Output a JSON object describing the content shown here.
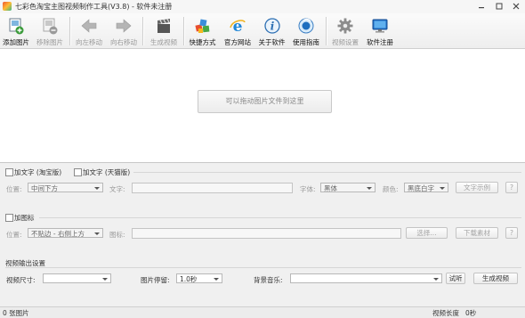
{
  "window": {
    "title": "七彩色淘宝主图视频制作工具(V3.8) - 软件未注册"
  },
  "toolbar": {
    "items": [
      {
        "label": "添加图片",
        "icon": "add-image-icon",
        "enabled": true
      },
      {
        "label": "移除图片",
        "icon": "remove-image-icon",
        "enabled": false
      },
      {
        "label": "向左移动",
        "icon": "arrow-left-icon",
        "enabled": false
      },
      {
        "label": "向右移动",
        "icon": "arrow-right-icon",
        "enabled": false
      },
      {
        "label": "生成视频",
        "icon": "clapperboard-icon",
        "enabled": false
      },
      {
        "label": "快捷方式",
        "icon": "shortcut-icon",
        "enabled": true
      },
      {
        "label": "官方网站",
        "icon": "ie-icon",
        "enabled": true
      },
      {
        "label": "关于软件",
        "icon": "info-icon",
        "enabled": true
      },
      {
        "label": "使用指南",
        "icon": "guide-icon",
        "enabled": true
      },
      {
        "label": "视频设置",
        "icon": "gear-icon",
        "enabled": false
      },
      {
        "label": "软件注册",
        "icon": "monitor-icon",
        "enabled": true
      }
    ]
  },
  "dropzone": {
    "label": "可以拖动图片文件到这里"
  },
  "text_section": {
    "add_text_taobao": "加文字 (淘宝版)",
    "add_text_tmall": "加文字 (天猫版)",
    "position_label": "位置:",
    "position_value": "中间下方",
    "text_label": "文字:",
    "font_label": "字体:",
    "font_value": "黑体",
    "color_label": "颜色:",
    "color_value": "黑底白字",
    "preview_button": "文字示例",
    "help_button": "?"
  },
  "icon_section": {
    "add_icon": "加图标",
    "position_label": "位置:",
    "position_value": "不贴边 - 右侧上方",
    "icon_label": "图标:",
    "choose_button": "选择...",
    "download_button": "下载素材",
    "help_button": "?"
  },
  "output_section": {
    "heading": "视频输出设置",
    "size_label": "视频尺寸:",
    "size_value": "",
    "duration_label": "图片停留:",
    "duration_value": "1.0秒",
    "music_label": "背景音乐:",
    "music_value": "",
    "listen_button": "试听",
    "generate_button": "生成视频"
  },
  "status": {
    "image_count": "0 张图片",
    "video_length_label": "视频长度",
    "video_length_value": "0秒"
  }
}
